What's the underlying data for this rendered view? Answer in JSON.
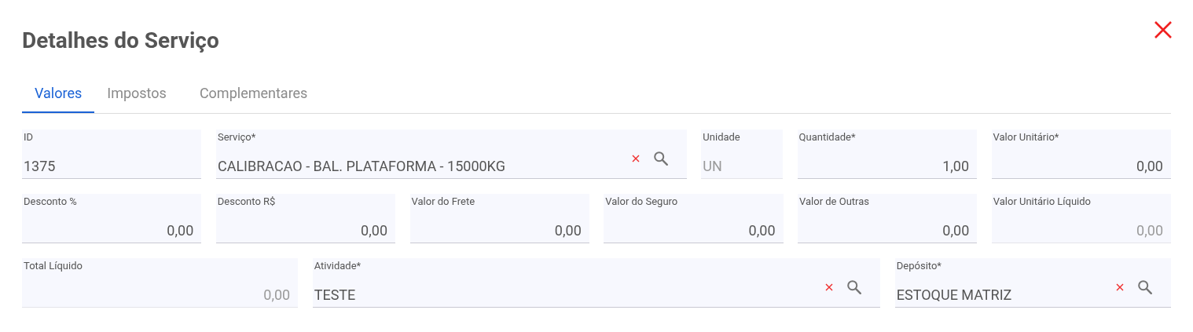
{
  "dialog": {
    "title": "Detalhes do Serviço"
  },
  "tabs": [
    {
      "label": "Valores",
      "selected": true
    },
    {
      "label": "Impostos",
      "selected": false
    },
    {
      "label": "Complementares",
      "selected": false
    }
  ],
  "rows": [
    {
      "fields": [
        {
          "label": "ID",
          "value": "1375",
          "kind": "text",
          "disabled": false
        },
        {
          "label": "Serviço*",
          "value": "CALIBRACAO - BAL. PLATAFORMA - 15000KG",
          "kind": "lookup",
          "disabled": false
        },
        {
          "label": "Unidade",
          "value": "UN",
          "kind": "text",
          "disabled": true
        },
        {
          "label": "Quantidade*",
          "value": "1,00",
          "kind": "number",
          "disabled": false
        },
        {
          "label": "Valor Unitário*",
          "value": "0,00",
          "kind": "number",
          "disabled": false
        }
      ]
    },
    {
      "fields": [
        {
          "label": "Desconto %",
          "value": "0,00",
          "kind": "number",
          "disabled": false
        },
        {
          "label": "Desconto R$",
          "value": "0,00",
          "kind": "number",
          "disabled": false
        },
        {
          "label": "Valor do Frete",
          "value": "0,00",
          "kind": "number",
          "disabled": false
        },
        {
          "label": "Valor do Seguro",
          "value": "0,00",
          "kind": "number",
          "disabled": false
        },
        {
          "label": "Valor de Outras",
          "value": "0,00",
          "kind": "number",
          "disabled": false
        },
        {
          "label": "Valor Unitário Líquido",
          "value": "0,00",
          "kind": "number",
          "disabled": true
        }
      ]
    },
    {
      "fields": [
        {
          "label": "Total Líquido",
          "value": "0,00",
          "kind": "number",
          "disabled": true
        },
        {
          "label": "Atividade*",
          "value": "TESTE",
          "kind": "lookup",
          "disabled": false
        },
        {
          "label": "Depósito*",
          "value": "ESTOQUE MATRIZ",
          "kind": "lookup",
          "disabled": false
        }
      ]
    }
  ]
}
